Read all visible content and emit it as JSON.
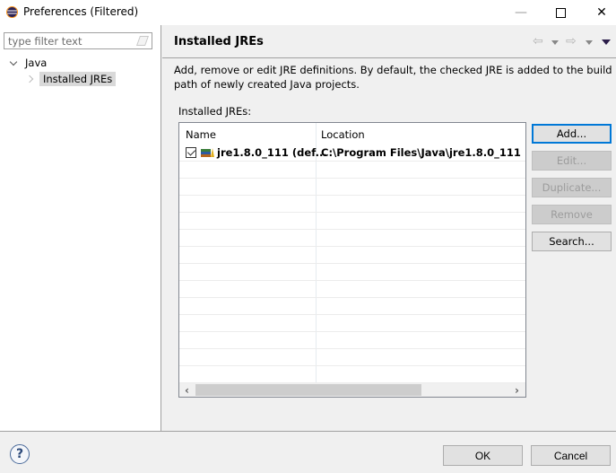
{
  "window": {
    "title": "Preferences (Filtered)",
    "minimize_icon": "minimize-icon",
    "maximize_icon": "maximize-icon",
    "close_icon": "close-icon"
  },
  "sidebar": {
    "filter_placeholder": "type filter text",
    "tree": [
      {
        "label": "Java",
        "expanded": true
      },
      {
        "label": "Installed JREs",
        "selected": true
      }
    ]
  },
  "page": {
    "title": "Installed JREs",
    "description": "Add, remove or edit JRE definitions. By default, the checked JRE is added to the build path of newly created Java projects.",
    "table_label": "Installed JREs:",
    "columns": [
      "Name",
      "Location"
    ],
    "rows": [
      {
        "checked": true,
        "name": "jre1.8.0_111 (def...",
        "location": "C:\\Program Files\\Java\\jre1.8.0_111"
      }
    ],
    "buttons": {
      "add": "Add...",
      "edit": "Edit...",
      "duplicate": "Duplicate...",
      "remove": "Remove",
      "search": "Search..."
    }
  },
  "footer": {
    "ok": "OK",
    "cancel": "Cancel",
    "help": "?"
  }
}
